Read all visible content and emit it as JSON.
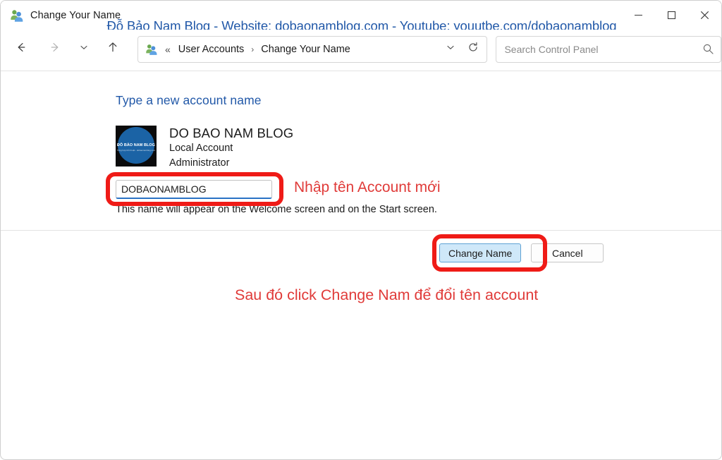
{
  "window": {
    "title": "Change Your Name",
    "app_icon": "user-accounts-icon",
    "controls": {
      "minimize": "minimize-icon",
      "maximize": "maximize-icon",
      "close": "close-icon"
    }
  },
  "watermark": {
    "text": "Đỗ Bảo Nam Blog - Website: dobaonamblog.com - Youtube: youutbe.com/dobaonamblog",
    "color": "#2158a8"
  },
  "navbar": {
    "back": "back-arrow-icon",
    "forward": "forward-arrow-icon",
    "recent": "chevron-down-icon",
    "up": "up-arrow-icon",
    "address": {
      "icon": "user-accounts-icon",
      "overflow": "«",
      "crumbs": [
        {
          "label": "User Accounts"
        },
        {
          "label": "Change Your Name"
        }
      ],
      "separator": "›",
      "dropdown": "chevron-down-icon",
      "refresh": "refresh-icon"
    },
    "search": {
      "placeholder": "Search Control Panel",
      "value": "",
      "icon": "search-icon"
    }
  },
  "content": {
    "heading": "Type a new account name",
    "account": {
      "avatar": {
        "name": "ĐỖ BẢO NAM BLOG",
        "subtitle": "Tổng hợp thủ thuật - dobaonamblog.com",
        "circle_color": "#1b63a5",
        "background_color": "#0b0b0c"
      },
      "display_name": "DO BAO NAM BLOG",
      "type": "Local Account",
      "role": "Administrator"
    },
    "name_input": {
      "value": "DOBAONAMBLOG",
      "placeholder": "",
      "focus_color": "#2a72c5"
    },
    "hint": "This name will appear on the Welcome screen and on the Start screen.",
    "buttons": {
      "primary": "Change Name",
      "secondary": "Cancel"
    }
  },
  "annotations": {
    "color": "#e03b39",
    "box_color": "#ef1b17",
    "input_note": "Nhập tên Account mới",
    "bottom_note": "Sau đó click Change Nam để đổi tên account"
  }
}
